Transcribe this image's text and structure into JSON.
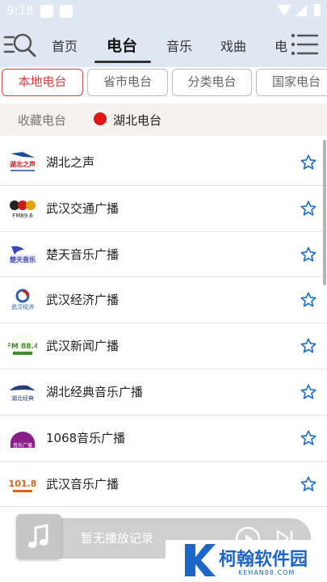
{
  "status_bar": {
    "time": "9:18"
  },
  "nav": {
    "tabs": [
      {
        "label": "首页"
      },
      {
        "label": "电台"
      },
      {
        "label": "音乐"
      },
      {
        "label": "戏曲"
      },
      {
        "label": "电"
      }
    ],
    "active_index": 1
  },
  "subtabs": [
    {
      "label": "本地电台"
    },
    {
      "label": "省市电台"
    },
    {
      "label": "分类电台"
    },
    {
      "label": "国家电台"
    }
  ],
  "favorites_bar": {
    "label": "收藏电台",
    "current_station": "湖北电台",
    "dot_color": "#e01515"
  },
  "stations": [
    {
      "name": "湖北之声",
      "logo": "hubei-zhisheng-logo",
      "logo_text": "湖北之声"
    },
    {
      "name": "武汉交通广播",
      "logo": "wuhan-traffic-logo",
      "logo_text": "FM89.6"
    },
    {
      "name": "楚天音乐广播",
      "logo": "chutian-music-logo",
      "logo_text": "楚天音乐"
    },
    {
      "name": "武汉经济广播",
      "logo": "wuhan-economy-logo",
      "logo_text": "武汉经济"
    },
    {
      "name": "武汉新闻广播",
      "logo": "wuhan-news-logo",
      "logo_text": "FM 88.4"
    },
    {
      "name": "湖北经典音乐广播",
      "logo": "hubei-classic-music-logo",
      "logo_text": "湖北经典"
    },
    {
      "name": "1068音乐广播",
      "logo": "music-1068-logo",
      "logo_text": "音乐广播"
    },
    {
      "name": "武汉音乐广播",
      "logo": "wuhan-music-logo",
      "logo_text": "101.8"
    }
  ],
  "player": {
    "status_text": "暂无播放记录"
  },
  "watermark": {
    "title": "柯翰软件园",
    "url": "KEHAN88.COM"
  },
  "colors": {
    "accent": "#e23a3a",
    "star": "#1a6fd1",
    "header_bg": "#dfe7f2",
    "watermark": "#1c66c9"
  }
}
